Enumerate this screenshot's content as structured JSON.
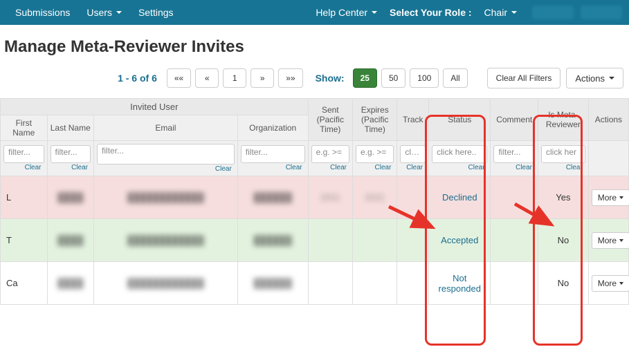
{
  "nav": {
    "submissions": "Submissions",
    "users": "Users",
    "settings": "Settings",
    "help_center": "Help Center",
    "select_role": "Select Your Role :",
    "role": "Chair"
  },
  "title": "Manage Meta-Reviewer Invites",
  "toolbar": {
    "page_range": "1 - 6 of 6",
    "pager_first": "««",
    "pager_prev": "«",
    "pager_page": "1",
    "pager_next": "»",
    "pager_last": "»»",
    "show_label": "Show:",
    "show_25": "25",
    "show_50": "50",
    "show_100": "100",
    "show_all": "All",
    "clear_all": "Clear All Filters",
    "actions": "Actions"
  },
  "headers": {
    "invited_user": "Invited User",
    "first_name": "First Name",
    "last_name": "Last Name",
    "email": "Email",
    "organization": "Organization",
    "sent": "Sent (Pacific Time)",
    "expires": "Expires (Pacific Time)",
    "track": "Track",
    "status": "Status",
    "comment": "Comment",
    "is_meta": "Is Meta-Reviewer",
    "actions": "Actions"
  },
  "filters": {
    "placeholder": "filter...",
    "eg_ge": "e.g. >=",
    "click_here": "click here..",
    "click_her": "click her",
    "clear": "Clear"
  },
  "rows": [
    {
      "first": "L",
      "last": "████",
      "email": "████████████",
      "org": "██████",
      "sent": "2021",
      "expires": "2021",
      "track": "",
      "status": "Declined",
      "comment": "",
      "is_meta": "Yes",
      "row_class": "row-red"
    },
    {
      "first": "T",
      "last": "████",
      "email": "████████████",
      "org": "██████",
      "sent": "",
      "expires": "",
      "track": "",
      "status": "Accepted",
      "comment": "",
      "is_meta": "No",
      "row_class": "row-green"
    },
    {
      "first": "Ca",
      "last": "████",
      "email": "████████████",
      "org": "██████",
      "sent": "",
      "expires": "",
      "track": "",
      "status": "Not responded",
      "comment": "",
      "is_meta": "No",
      "row_class": "row-white"
    }
  ],
  "more_label": "More"
}
